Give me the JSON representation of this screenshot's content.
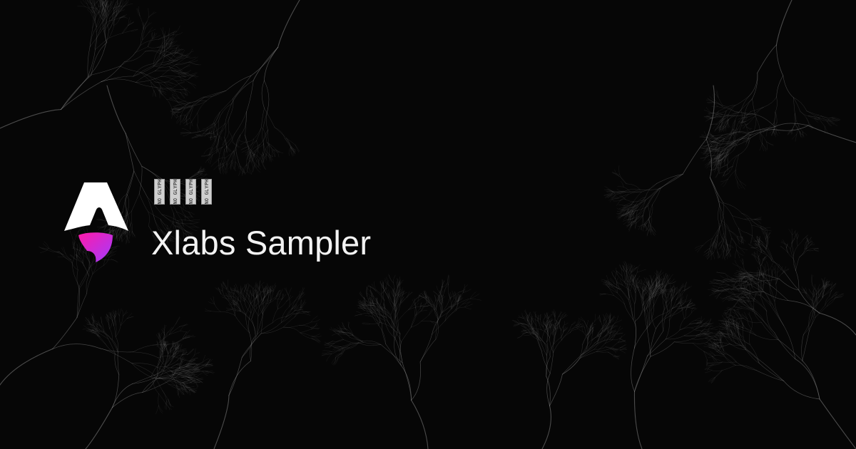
{
  "eyebrow": {
    "glyphs": [
      "NO GLYPH",
      "NO GLYPH",
      "NO GLYPH",
      "NO GLYPH"
    ]
  },
  "title": "Xlabs Sampler",
  "logo": {
    "icon": "astro-rocket-logo-icon",
    "colors": {
      "body": "#ffffff",
      "flame_start": "#ff1aa8",
      "flame_end": "#a23bff"
    }
  },
  "colors": {
    "background": "#060606",
    "title_text": "#f3f3f3",
    "texture_strokes": "#8a8a8a"
  }
}
